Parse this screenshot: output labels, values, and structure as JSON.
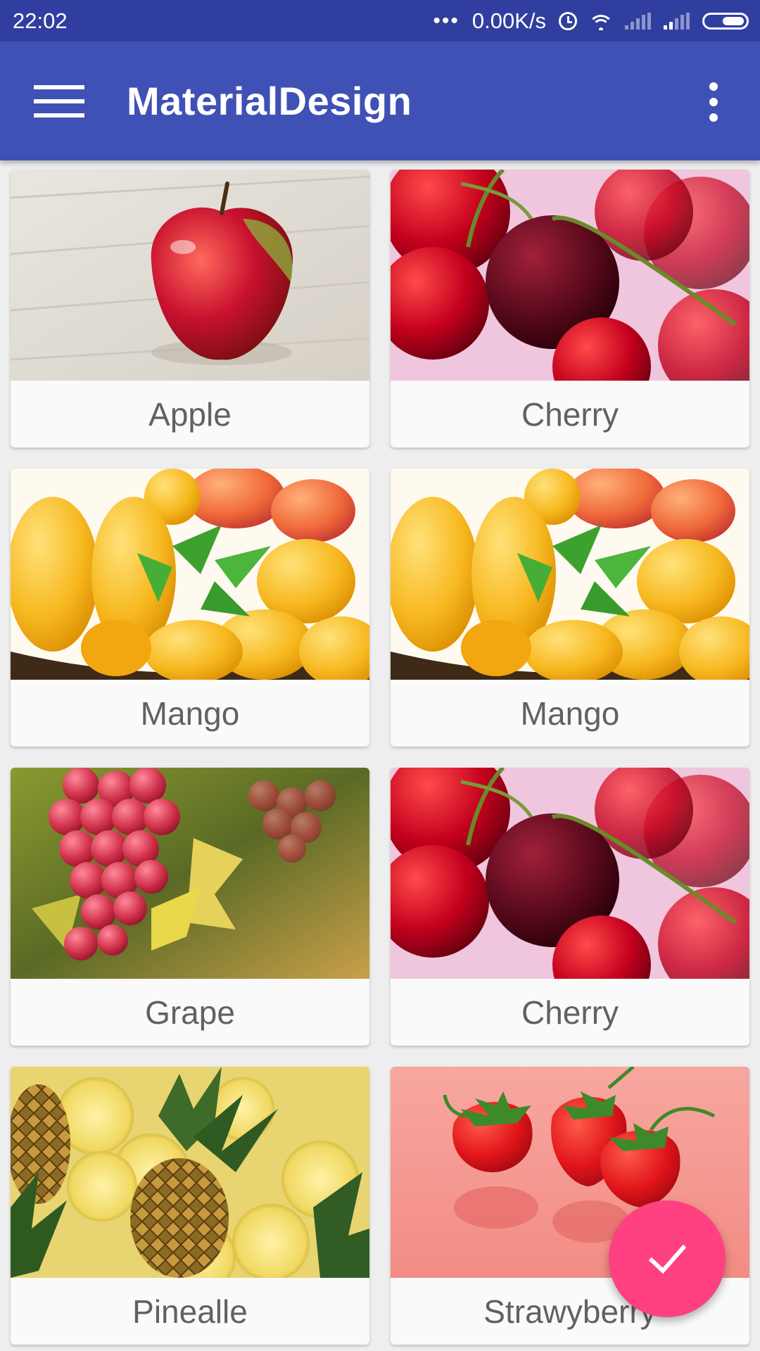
{
  "status_bar": {
    "time": "22:02",
    "network_speed": "0.00K/s",
    "icons": [
      "more-dots-icon",
      "alarm-icon",
      "wifi-icon",
      "signal-icon",
      "signal-icon",
      "battery-icon"
    ]
  },
  "toolbar": {
    "title": "MaterialDesign",
    "menu_icon": "hamburger-menu-icon",
    "overflow_icon": "overflow-menu-icon",
    "color": "#3f51b5"
  },
  "fruits": [
    {
      "name": "Apple",
      "image": "apple"
    },
    {
      "name": "Cherry",
      "image": "cherry"
    },
    {
      "name": "Mango",
      "image": "mango"
    },
    {
      "name": "Mango",
      "image": "mango"
    },
    {
      "name": "Grape",
      "image": "grape"
    },
    {
      "name": "Cherry",
      "image": "cherry"
    },
    {
      "name": "Pinealle",
      "image": "pineapple"
    },
    {
      "name": "Strawyberry",
      "image": "strawberry"
    }
  ],
  "fab": {
    "icon": "check-icon",
    "color": "#ff4081"
  }
}
